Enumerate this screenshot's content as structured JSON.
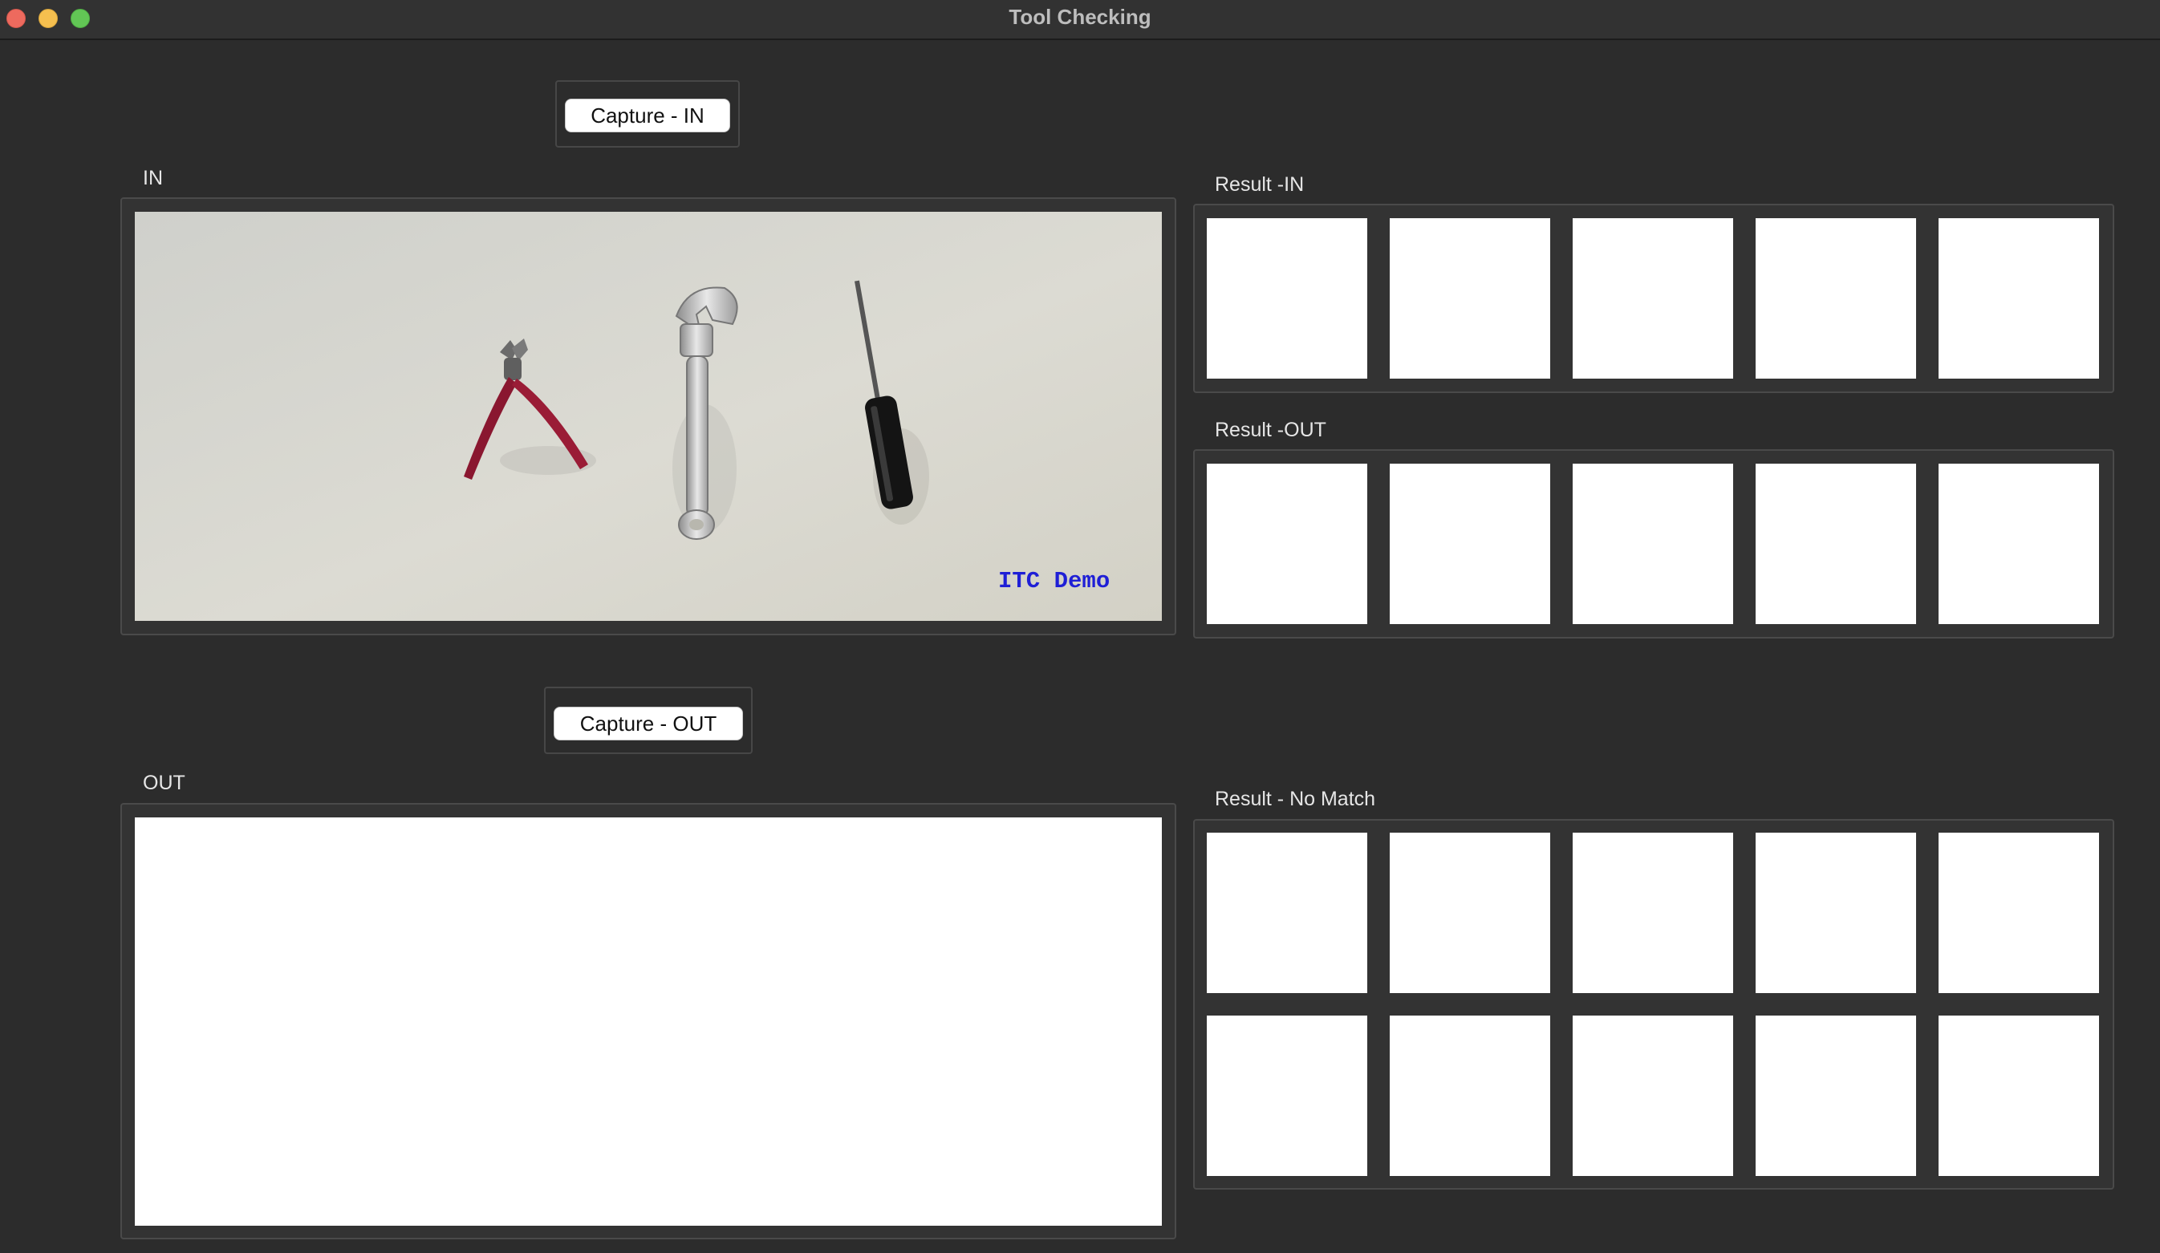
{
  "window": {
    "title": "Tool Checking"
  },
  "capture_in": {
    "label": "Capture - IN"
  },
  "capture_out": {
    "label": "Capture - OUT"
  },
  "sections": {
    "in_label": "IN",
    "out_label": "OUT",
    "result_in_label": "Result -IN",
    "result_out_label": "Result -OUT",
    "result_nomatch_label": "Result - No Match"
  },
  "in_image": {
    "overlay_text": "ITC Demo",
    "objects": [
      "pliers-icon",
      "wrench-icon",
      "screwdriver-icon"
    ]
  },
  "colors": {
    "background": "#2c2c2c",
    "panel": "#333333",
    "slot": "#ffffff",
    "watermark": "#1f1fd6"
  }
}
